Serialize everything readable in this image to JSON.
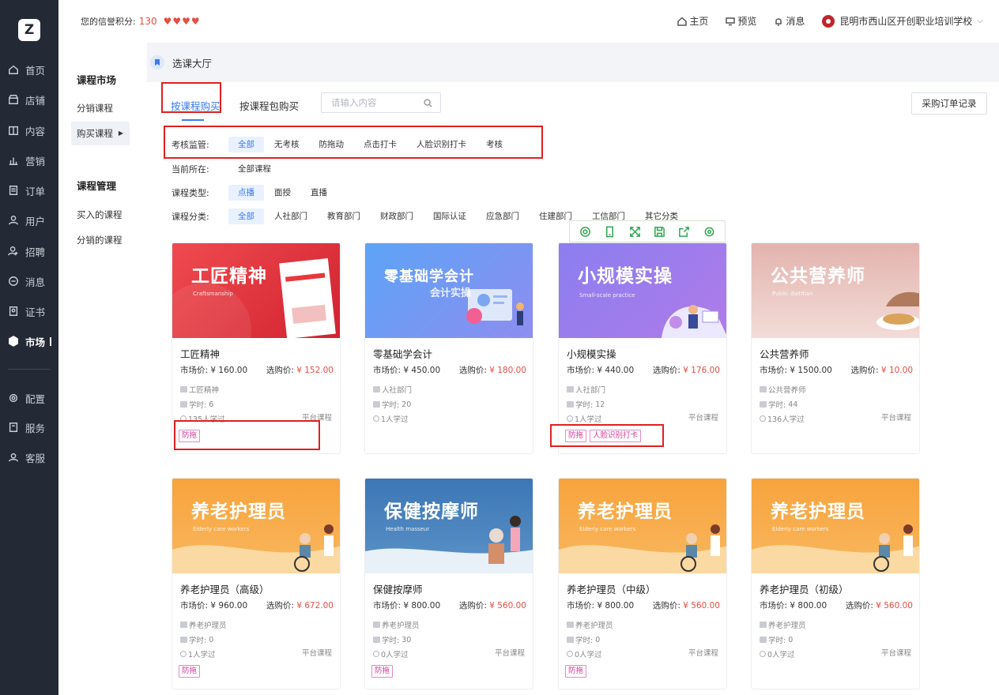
{
  "sidebar": {
    "logo": "Z",
    "items": [
      {
        "label": "首页",
        "icon": "home-icon"
      },
      {
        "label": "店铺",
        "icon": "store-icon"
      },
      {
        "label": "内容",
        "icon": "book-icon"
      },
      {
        "label": "营销",
        "icon": "chart-icon"
      },
      {
        "label": "订单",
        "icon": "order-icon"
      },
      {
        "label": "用户",
        "icon": "user-icon"
      },
      {
        "label": "招聘",
        "icon": "recruit-icon"
      },
      {
        "label": "消息",
        "icon": "message-icon"
      },
      {
        "label": "证书",
        "icon": "certificate-icon"
      },
      {
        "label": "市场",
        "icon": "market-icon"
      },
      {
        "label": "配置",
        "icon": "gear-icon"
      },
      {
        "label": "服务",
        "icon": "service-icon"
      },
      {
        "label": "客服",
        "icon": "support-icon"
      }
    ]
  },
  "header": {
    "credit_label": "您的信誉积分:",
    "credit_score": "130",
    "hearts": [
      "♥",
      "♥",
      "♥",
      "♥"
    ],
    "links": {
      "home": "主页",
      "preview": "预览",
      "message": "消息"
    },
    "school": "昆明市西山区开创职业培训学校"
  },
  "submenu": {
    "group1": "课程市场",
    "distribute_courses": "分销课程",
    "buy_courses": "购买课程",
    "group2": "课程管理",
    "bought_courses": "买入的课程",
    "distributed_courses": "分销的课程"
  },
  "breadcrumb": {
    "title": "选课大厅"
  },
  "tabs": {
    "by_course": "按课程购买",
    "by_package": "按课程包购买"
  },
  "search": {
    "placeholder": "请输入内容"
  },
  "order_button": "采购订单记录",
  "filters": {
    "supervision": {
      "label": "考核监管:",
      "options": [
        "全部",
        "无考核",
        "防拖动",
        "点击打卡",
        "人脸识别打卡",
        "考核"
      ]
    },
    "location": {
      "label": "当前所在:",
      "value": "全部课程"
    },
    "type": {
      "label": "课程类型:",
      "options": [
        "点播",
        "面授",
        "直播"
      ]
    },
    "category": {
      "label": "课程分类:",
      "options": [
        "全部",
        "人社部门",
        "教育部门",
        "财政部门",
        "国际认证",
        "应急部门",
        "住建部门",
        "工信部门",
        "其它分类"
      ]
    }
  },
  "labels": {
    "market_price": "市场价:",
    "select_price": "选购价:",
    "hours": "学时:",
    "platform": "平台课程"
  },
  "courses": [
    {
      "cover_title": "工匠精神",
      "cover_sub": "Craftsmanship",
      "name": "工匠精神",
      "market": "¥ 160.00",
      "select": "¥ 152.00",
      "category": "工匠精神",
      "hours": "6",
      "learners": "135人学过",
      "tags": [
        "防拖"
      ],
      "color": "#e8383d"
    },
    {
      "cover_title": "零基础学会计",
      "cover_sub": "会计实操",
      "name": "零基础学会计",
      "market": "¥ 450.00",
      "select": "¥ 180.00",
      "category": "人社部门",
      "hours": "20",
      "learners": "1人学过",
      "tags": [],
      "color": "#6aa0f5"
    },
    {
      "cover_title": "小规模实操",
      "cover_sub": "Small-scale practice",
      "name": "小规模实操",
      "market": "¥ 440.00",
      "select": "¥ 176.00",
      "category": "人社部门",
      "hours": "12",
      "learners": "1人学过",
      "tags": [
        "防拖",
        "人脸识别打卡"
      ],
      "color": "#8d7ff0"
    },
    {
      "cover_title": "公共营养师",
      "cover_sub": "Public dietitian",
      "name": "公共营养师",
      "market": "¥ 1500.00",
      "select": "¥ 10.00",
      "category": "公共营养师",
      "hours": "44",
      "learners": "136人学过",
      "tags": [],
      "color": "#d9a9a4"
    },
    {
      "cover_title": "养老护理员",
      "cover_sub": "Elderly care workers",
      "name": "养老护理员（高级）",
      "market": "¥ 960.00",
      "select": "¥ 672.00",
      "category": "养老护理员",
      "hours": "0",
      "learners": "1人学过",
      "tags": [
        "防拖"
      ],
      "color": "#f6a23e"
    },
    {
      "cover_title": "保健按摩师",
      "cover_sub": "Health masseur",
      "name": "保健按摩师",
      "market": "¥ 800.00",
      "select": "¥ 560.00",
      "category": "养老护理员",
      "hours": "30",
      "learners": "0人学过",
      "tags": [
        "防拖"
      ],
      "color": "#3d79b7"
    },
    {
      "cover_title": "养老护理员",
      "cover_sub": "Elderly care workers",
      "name": "养老护理员（中级）",
      "market": "¥ 800.00",
      "select": "¥ 560.00",
      "category": "养老护理员",
      "hours": "0",
      "learners": "0人学过",
      "tags": [
        "防拖"
      ],
      "color": "#f6a23e"
    },
    {
      "cover_title": "养老护理员",
      "cover_sub": "Elderly care workers",
      "name": "养老护理员（初级）",
      "market": "¥ 800.00",
      "select": "¥ 560.00",
      "category": "养老护理员",
      "hours": "0",
      "learners": "0人学过",
      "tags": [],
      "color": "#f6a23e"
    }
  ]
}
